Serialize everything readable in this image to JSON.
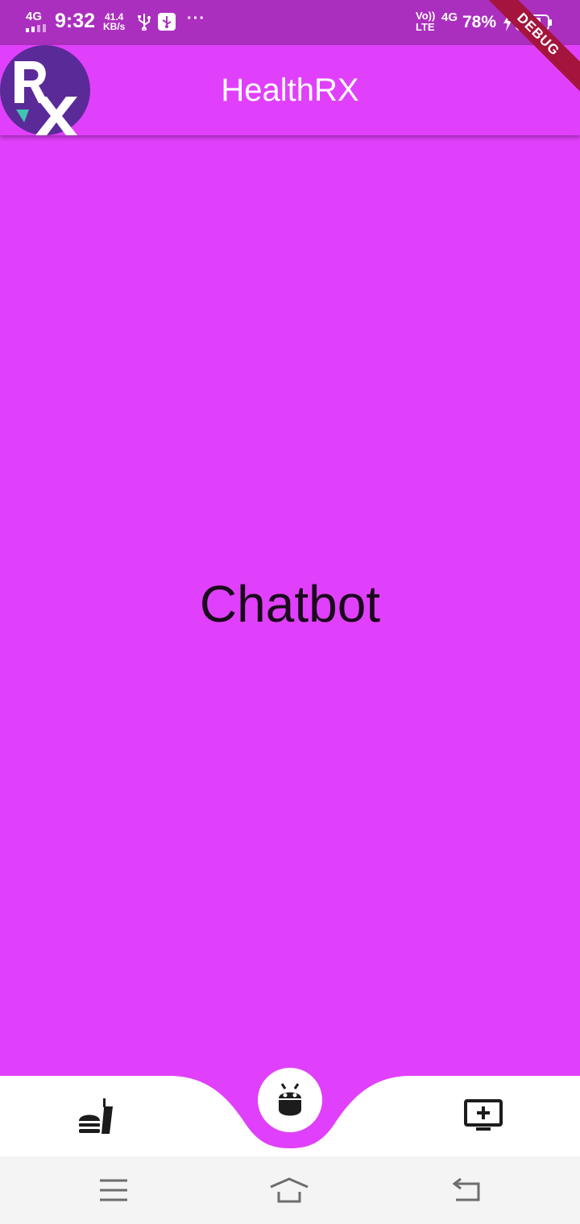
{
  "status_bar": {
    "network_type": "4G",
    "time": "9:32",
    "speed_value": "41.4",
    "speed_unit": "KB/s",
    "more": "···",
    "volte_top": "Vo))",
    "volte_bottom": "LTE",
    "network_right": "4G",
    "battery_percent": "78%"
  },
  "debug_banner": "DEBUG",
  "app_bar": {
    "title": "HealthRX",
    "logo_icon": "rx-logo-icon"
  },
  "body": {
    "page_text": "Chatbot"
  },
  "bottom_nav": {
    "items": [
      {
        "icon": "fastfood-icon"
      },
      {
        "icon": "android-icon",
        "selected": true
      },
      {
        "icon": "add-to-queue-icon"
      }
    ]
  },
  "system_nav": {
    "items": [
      {
        "icon": "menu-icon"
      },
      {
        "icon": "home-icon"
      },
      {
        "icon": "back-icon"
      }
    ]
  },
  "colors": {
    "primary": "#e040fb",
    "status_bar": "#ab2fbf",
    "nav_background": "#ffffff",
    "debug_ribbon": "#a4143c",
    "logo_background": "#5b2a99",
    "logo_accent": "#3ec6b0"
  }
}
